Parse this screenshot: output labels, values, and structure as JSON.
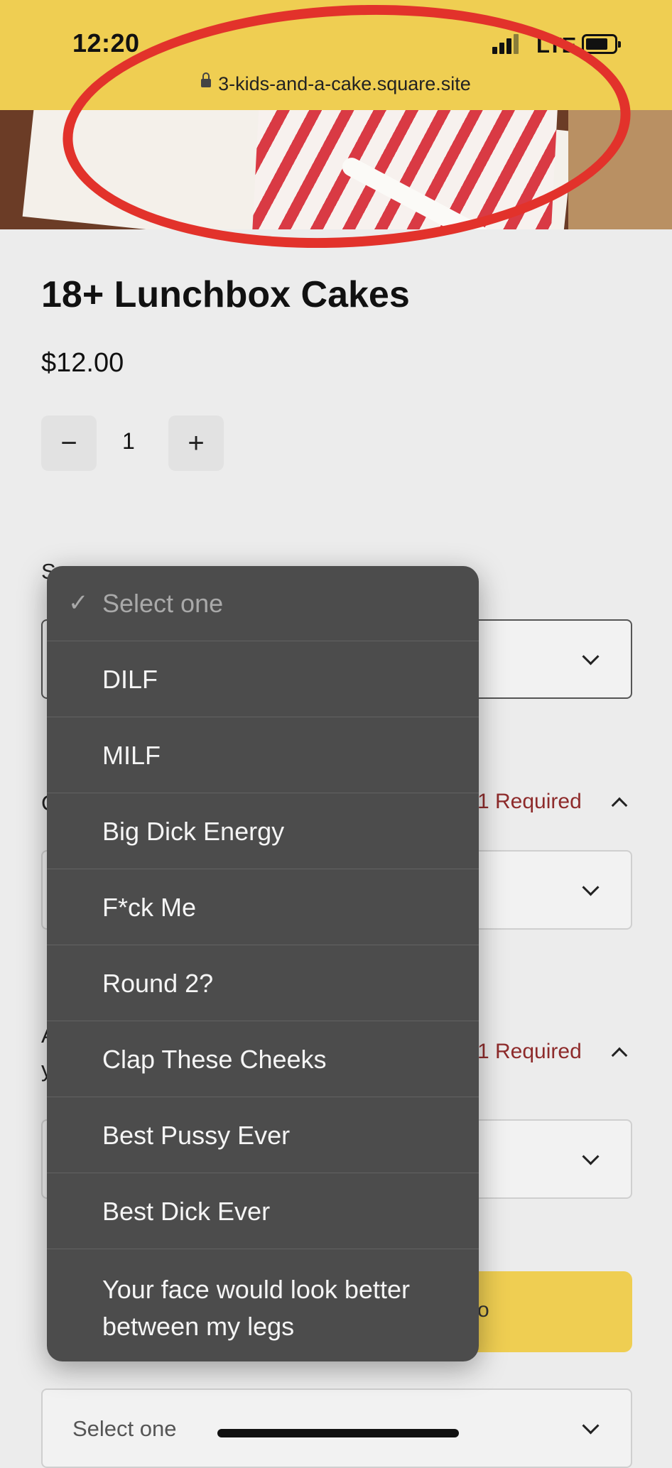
{
  "status_bar": {
    "time": "12:20",
    "network": "LTE",
    "url": "3-kids-and-a-cake.square.site"
  },
  "product": {
    "title": "18+ Lunchbox Cakes",
    "price": "$12.00",
    "quantity": "1"
  },
  "quantity_controls": {
    "minus": "−",
    "plus": "+"
  },
  "options": {
    "label_fragment": "S",
    "label_fragment_2": "C",
    "label_fragment_3": "A",
    "label_fragment_4": "y",
    "required_label": "1 Required",
    "add_button_fragment": "o"
  },
  "bottom_select": {
    "placeholder": "Select one"
  },
  "dropdown": {
    "items": [
      {
        "label": "Select one",
        "selected": true
      },
      {
        "label": "DILF"
      },
      {
        "label": "MILF"
      },
      {
        "label": "Big Dick Energy"
      },
      {
        "label": "F*ck Me"
      },
      {
        "label": "Round 2?"
      },
      {
        "label": "Clap These Cheeks"
      },
      {
        "label": "Best Pussy Ever"
      },
      {
        "label": "Best Dick Ever"
      },
      {
        "label": "Your face would look better between my legs"
      }
    ]
  },
  "colors": {
    "header_yellow": "#efce52",
    "required_red": "#8e2b2b",
    "annotation_red": "#e2322b",
    "menu_bg": "#4c4c4c"
  }
}
